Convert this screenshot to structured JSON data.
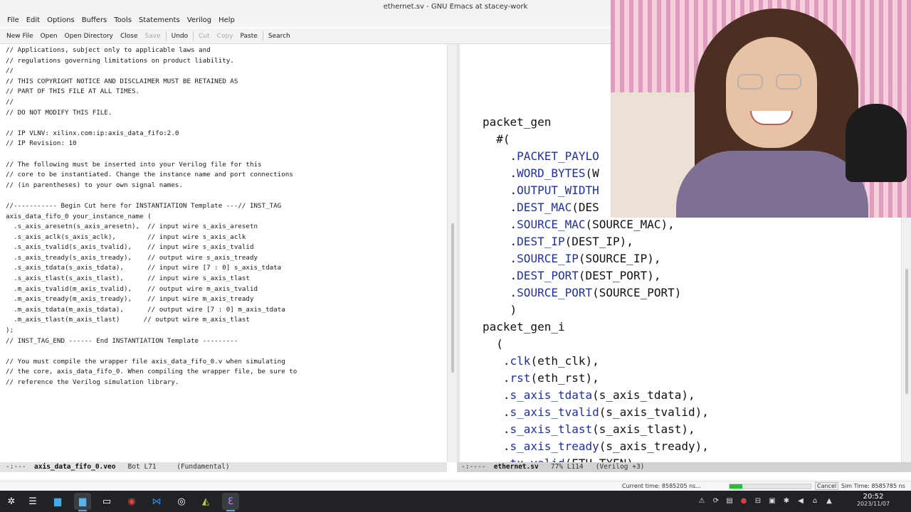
{
  "window_title": "ethernet.sv - GNU Emacs at stacey-work",
  "menu": [
    "File",
    "Edit",
    "Options",
    "Buffers",
    "Tools",
    "Statements",
    "Verilog",
    "Help"
  ],
  "toolbar": {
    "new_file": "New File",
    "open": "Open",
    "open_directory": "Open Directory",
    "close": "Close",
    "save": "Save",
    "undo": "Undo",
    "cut": "Cut",
    "copy": "Copy",
    "paste": "Paste",
    "search": "Search"
  },
  "left_buffer": {
    "lines": [
      "// Applications, subject only to applicable laws and",
      "// regulations governing limitations on product liability.",
      "//",
      "// THIS COPYRIGHT NOTICE AND DISCLAIMER MUST BE RETAINED AS",
      "// PART OF THIS FILE AT ALL TIMES.",
      "//",
      "// DO NOT MODIFY THIS FILE.",
      "",
      "// IP VLNV: xilinx.com:ip:axis_data_fifo:2.0",
      "// IP Revision: 10",
      "",
      "// The following must be inserted into your Verilog file for this",
      "// core to be instantiated. Change the instance name and port connections",
      "// (in parentheses) to your own signal names.",
      "",
      "//----------- Begin Cut here for INSTANTIATION Template ---// INST_TAG",
      "axis_data_fifo_0 your_instance_name (",
      "  .s_axis_aresetn(s_axis_aresetn),  // input wire s_axis_aresetn",
      "  .s_axis_aclk(s_axis_aclk),        // input wire s_axis_aclk",
      "  .s_axis_tvalid(s_axis_tvalid),    // input wire s_axis_tvalid",
      "  .s_axis_tready(s_axis_tready),    // output wire s_axis_tready",
      "  .s_axis_tdata(s_axis_tdata),      // input wire [7 : 0] s_axis_tdata",
      "  .s_axis_tlast(s_axis_tlast),      // input wire s_axis_tlast",
      "  .m_axis_tvalid(m_axis_tvalid),    // output wire m_axis_tvalid",
      "  .m_axis_tready(m_axis_tready),    // input wire m_axis_tready",
      "  .m_axis_tdata(m_axis_tdata),      // output wire [7 : 0] m_axis_tdata",
      "  .m_axis_tlast(m_axis_tlast)      // output wire m_axis_tlast",
      ");",
      "// INST_TAG_END ------ End INSTANTIATION Template ---------",
      "",
      "// You must compile the wrapper file axis_data_fifo_0.v when simulating",
      "// the core, axis_data_fifo_0. When compiling the wrapper file, be sure to",
      "// reference the Verilog simulation library."
    ]
  },
  "right_buffer": {
    "lines": [
      {
        "indent": "",
        "kw": "",
        "text": "packet_gen"
      },
      {
        "indent": "  ",
        "kw": "",
        "text": "#("
      },
      {
        "indent": "    .",
        "kw": "PACKET_PAYLO",
        "text": ""
      },
      {
        "indent": "    .",
        "kw": "WORD_BYTES",
        "text": "(W"
      },
      {
        "indent": "    .",
        "kw": "OUTPUT_WIDTH",
        "text": ""
      },
      {
        "indent": "    .",
        "kw": "DEST_MAC",
        "text": "(DES"
      },
      {
        "indent": "    .",
        "kw": "SOURCE_MAC",
        "text": "(SOURCE_MAC),"
      },
      {
        "indent": "    .",
        "kw": "DEST_IP",
        "text": "(DEST_IP),"
      },
      {
        "indent": "    .",
        "kw": "SOURCE_IP",
        "text": "(SOURCE_IP),"
      },
      {
        "indent": "    .",
        "kw": "DEST_PORT",
        "text": "(DEST_PORT),"
      },
      {
        "indent": "    .",
        "kw": "SOURCE_PORT",
        "text": "(SOURCE_PORT)"
      },
      {
        "indent": "    ",
        "kw": "",
        "text": ")"
      },
      {
        "indent": "",
        "kw": "",
        "text": "packet_gen_i"
      },
      {
        "indent": "  ",
        "kw": "",
        "text": "("
      },
      {
        "indent": "   .",
        "kw": "clk",
        "text": "(eth_clk),"
      },
      {
        "indent": "   .",
        "kw": "rst",
        "text": "(eth_rst),"
      },
      {
        "indent": "   .",
        "kw": "s_axis_tdata",
        "text": "(s_axis_tdata),"
      },
      {
        "indent": "   .",
        "kw": "s_axis_tvalid",
        "text": "(s_axis_tvalid),"
      },
      {
        "indent": "   .",
        "kw": "s_axis_tlast",
        "text": "(s_axis_tlast),"
      },
      {
        "indent": "   .",
        "kw": "s_axis_tready",
        "text": "(s_axis_tready),"
      },
      {
        "indent": "   .",
        "kw": "tx_valid",
        "text": "(ETH_TXEN)"
      }
    ]
  },
  "modeline_left": {
    "prefix": "-:---  ",
    "buffer": "axis_data_fifo_0.veo",
    "pos": "   Bot L71     (Fundamental)"
  },
  "modeline_right": {
    "prefix": "-:----  ",
    "buffer": "ethernet.sv",
    "pos": "   77% L114   (Verilog +3)"
  },
  "status": {
    "current_time": "Current time: 8585205 ns...",
    "progress": 0.16,
    "cancel": "Cancel",
    "sim_time": "Sim Time: 8585785 ns"
  },
  "clock": {
    "time": "20:52",
    "date": "2023/11/07"
  },
  "colors": {
    "keyword": "#1f2fa8",
    "progress": "#23c13a",
    "taskbar": "#202225"
  }
}
